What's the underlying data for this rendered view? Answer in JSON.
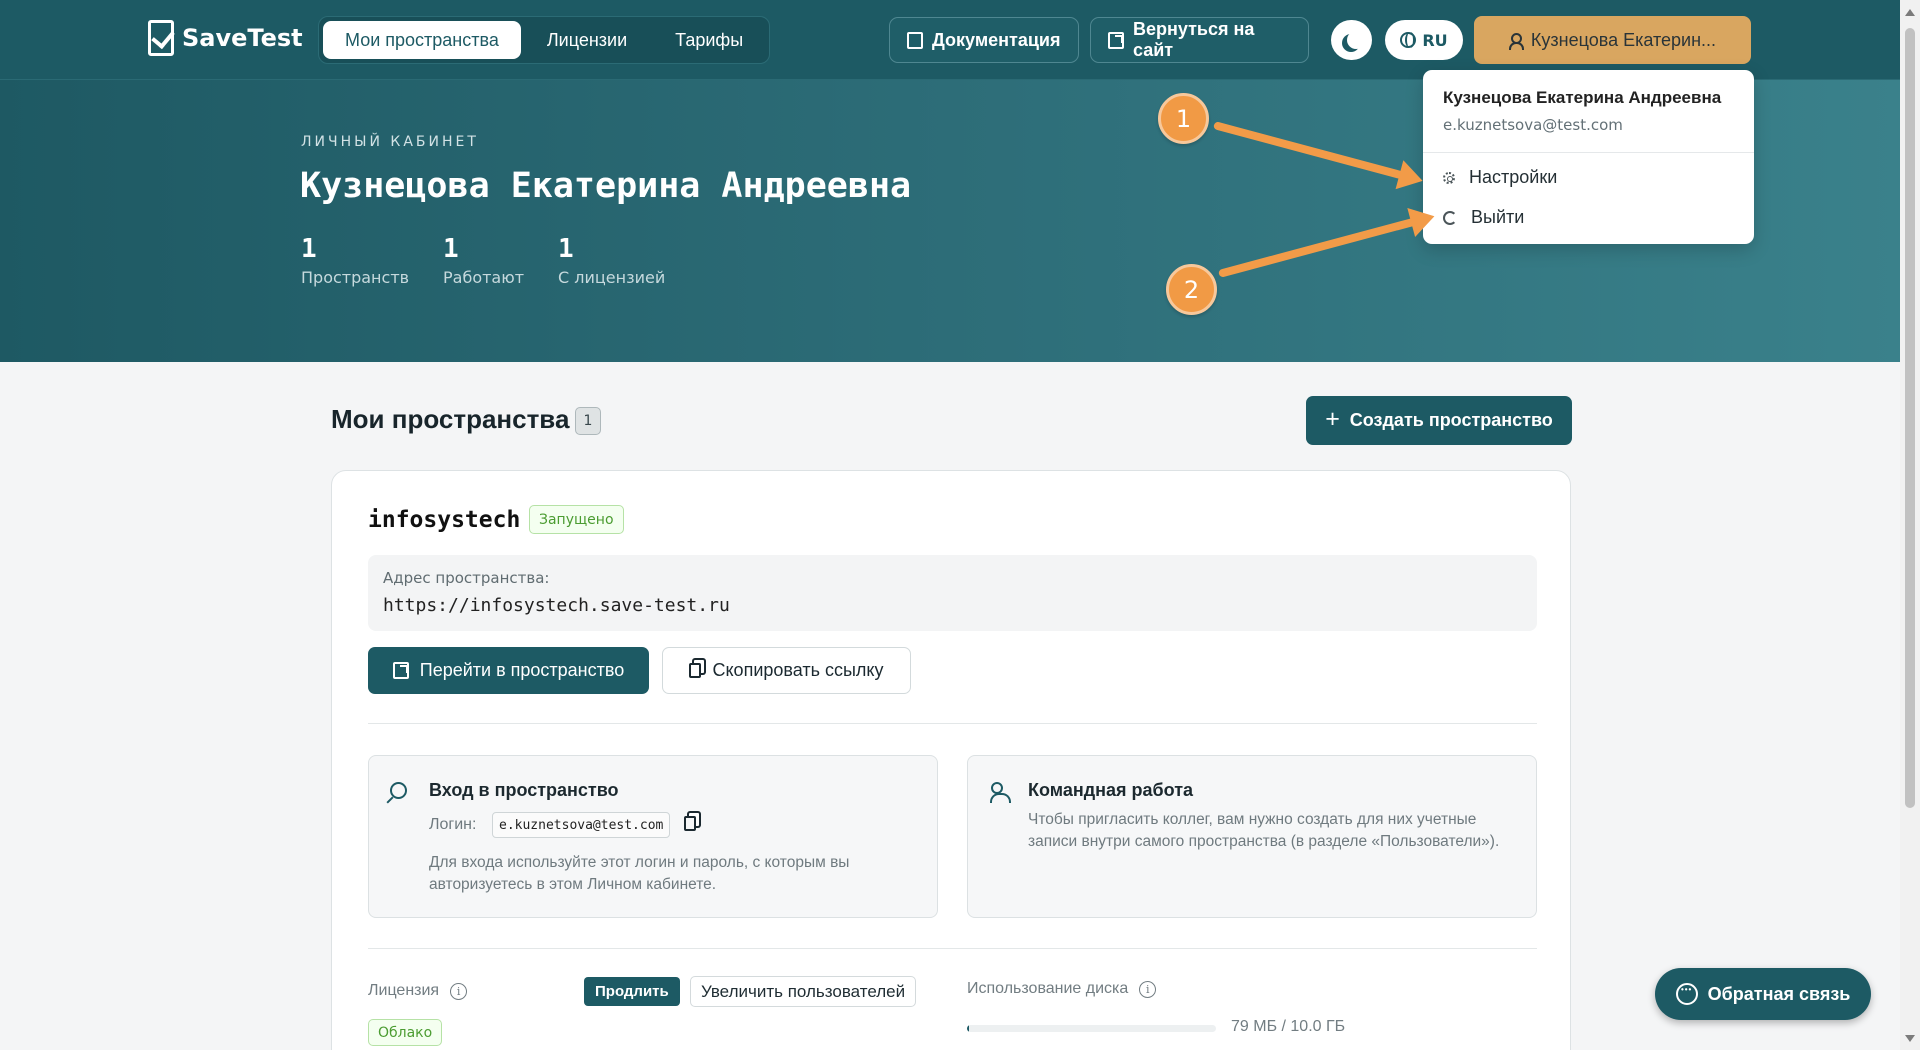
{
  "header": {
    "brand": "SaveTest",
    "tabs": [
      "Мои пространства",
      "Лицензии",
      "Тарифы"
    ],
    "documentation": "Документация",
    "back_to_site": "Вернуться на сайт",
    "language": "RU",
    "user_button": "Кузнецова Екатерин..."
  },
  "hero": {
    "eyebrow": "ЛИЧНЫЙ КАБИНЕТ",
    "name": "Кузнецова Екатерина Андреевна",
    "stats": [
      {
        "value": "1",
        "label": "Пространств"
      },
      {
        "value": "1",
        "label": "Работают"
      },
      {
        "value": "1",
        "label": "С лицензией"
      }
    ]
  },
  "dropdown": {
    "name": "Кузнецова Екатерина Андреевна",
    "email": "e.kuznetsova@test.com",
    "settings": "Настройки",
    "logout": "Выйти"
  },
  "annotations": {
    "one": "1",
    "two": "2"
  },
  "main": {
    "title": "Мои пространства",
    "count": "1",
    "create_button": "Создать пространство"
  },
  "space": {
    "name": "infosystech",
    "status": "Запущено",
    "address_label": "Адрес пространства:",
    "address": "https://infosystech.save-test.ru",
    "go_button": "Перейти в пространство",
    "copy_button": "Скопировать ссылку",
    "access_title": "Вход в пространство",
    "login_label": "Логин:",
    "login_value": "e.kuznetsova@test.com",
    "access_text": "Для входа используйте этот логин и пароль, с которым вы авторизуетесь в этом Личном кабинете.",
    "team_title": "Командная работа",
    "team_text": "Чтобы пригласить коллег, вам нужно создать для них учетные записи внутри самого пространства (в разделе «Пользователи»).",
    "license_label": "Лицензия",
    "extend_button": "Продлить",
    "increase_button": "Увеличить пользователей",
    "license_type": "Облако",
    "disk_label": "Использование диска",
    "disk_value": "79 МБ / 10.0 ГБ",
    "disk_used_fraction": 0.0077
  },
  "feedback": "Обратная связь",
  "colors": {
    "primary": "#1d5a64",
    "accent": "#d9a660",
    "annotation": "#f19a45",
    "success": "#4b9c31"
  }
}
